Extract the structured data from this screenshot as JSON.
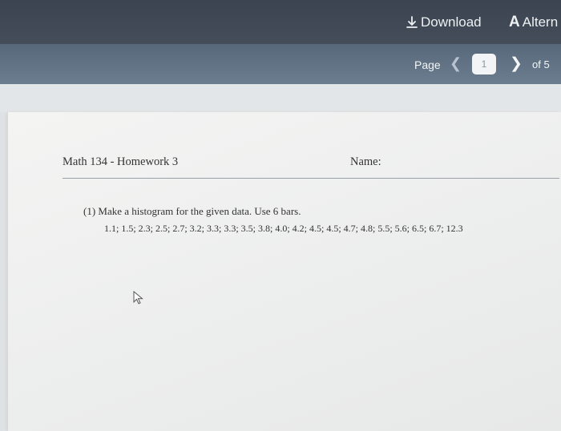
{
  "toolbar": {
    "download_label": "Download",
    "alt_label": "Altern",
    "download_icon": "download-icon",
    "alt_icon": "accessibility-a-icon"
  },
  "pager": {
    "page_label": "Page",
    "prev_icon": "chevron-left-icon",
    "current_page": "1",
    "next_icon": "chevron-right-icon",
    "total_label": "of 5"
  },
  "document": {
    "course_title": "Math 134 - Homework 3",
    "name_label": "Name:",
    "problem_text": "(1) Make a histogram for the given data. Use 6 bars.",
    "data_values": "1.1; 1.5; 2.3; 2.5; 2.7; 3.2; 3.3; 3.3; 3.5; 3.8; 4.0; 4.2; 4.5; 4.5; 4.7; 4.8; 5.5; 5.6; 6.5; 6.7; 12.3"
  },
  "colors": {
    "topbar": "#3f4854",
    "pagebar": "#617384",
    "paper": "#efefee"
  }
}
